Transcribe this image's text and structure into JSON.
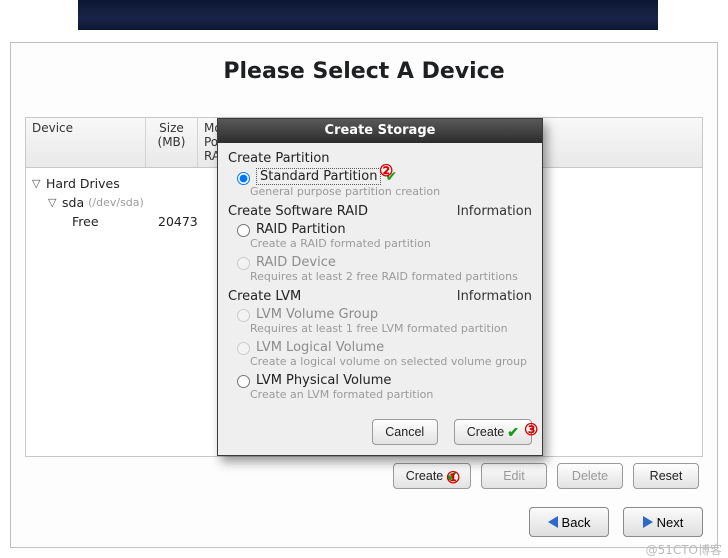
{
  "page": {
    "title": "Please Select A Device"
  },
  "table": {
    "headers": {
      "device": "Device",
      "size": "Size\n(MB)",
      "mount": "Mount Point/\nRAID/Volume"
    },
    "rows": {
      "hard_drives": "Hard Drives",
      "sda": "sda",
      "sda_dev": "(/dev/sda)",
      "free": "Free",
      "free_size": "20473"
    }
  },
  "modal": {
    "title": "Create Storage",
    "sections": {
      "partition": "Create Partition",
      "raid": "Create Software RAID",
      "lvm": "Create LVM",
      "info": "Information"
    },
    "options": {
      "standard_partition": "Standard Partition",
      "standard_hint": "General purpose partition creation",
      "raid_partition": "RAID Partition",
      "raid_partition_hint": "Create a RAID formated partition",
      "raid_device": "RAID Device",
      "raid_device_hint": "Requires at least 2 free RAID formated partitions",
      "lvm_vg": "LVM Volume Group",
      "lvm_vg_hint": "Requires at least 1 free LVM formated partition",
      "lvm_lv": "LVM Logical Volume",
      "lvm_lv_hint": "Create a logical volume on selected volume group",
      "lvm_pv": "LVM Physical Volume",
      "lvm_pv_hint": "Create an LVM formated partition"
    },
    "buttons": {
      "cancel": "Cancel",
      "create": "Create"
    }
  },
  "toolbar": {
    "create": "Create",
    "edit": "Edit",
    "delete": "Delete",
    "reset": "Reset"
  },
  "nav": {
    "back": "Back",
    "next": "Next"
  },
  "annotations": {
    "a1": "①",
    "a2": "②",
    "a3": "③"
  },
  "watermark": "@51CTO博客"
}
